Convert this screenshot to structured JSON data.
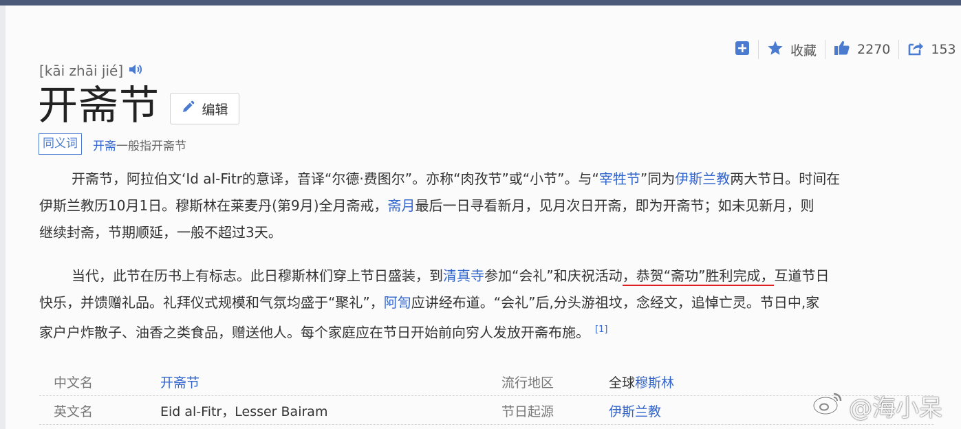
{
  "colors": {
    "accent": "#3366cc",
    "icon_blue": "#4a7bd0",
    "annotation": "#e02020"
  },
  "toolbar": {
    "add_icon": "plus-square-icon",
    "favorite_icon": "star-icon",
    "favorite_label": "收藏",
    "like_icon": "thumbs-up-icon",
    "like_count": "2270",
    "share_icon": "share-icon",
    "share_count": "153"
  },
  "entry": {
    "pinyin": "[kāi zhāi jié]",
    "speaker_icon": "speaker-icon",
    "title": "开斋节",
    "edit_label": "编辑",
    "synonym_badge": "同义词",
    "synonym_link": "开斋",
    "synonym_rest": "一般指开斋节"
  },
  "para1": {
    "l1_a": "开斋节，阿拉伯文‘Id al-Fitr的意译，音译“尔德·费图尔”。亦称“肉孜节”或“小节”。与“",
    "l1_link1": "宰牲节",
    "l1_b": "”同为",
    "l1_link2": "伊斯兰教",
    "l1_c": "两大节日。时间在",
    "l2_a": "伊斯兰教历10月1日。穆斯林在莱麦丹(第9月)全月斋戒，",
    "l2_link": "斋月",
    "l2_b": "最后一日寻看新月，见月次日开斋，即为开斋节；如未见新月，则",
    "l3": "继续封斋，节期顺延，一般不超过3天。"
  },
  "para2": {
    "l1_a": "当代，此节在历书上有标志。此日穆斯林们穿上节日盛装，到",
    "l1_link": "清真寺",
    "l1_b": "参加“会礼”和庆祝活动",
    "l1_underlined": "，恭贺“斋功”胜利完成，",
    "l1_c": "互道节日",
    "l2_a": "快乐，并馈赠礼品。礼拜仪式规模和气氛均盛于“聚礼”，",
    "l2_link": "阿訇",
    "l2_b": "应讲经布道。“会礼”后,分头游祖坟，念经文，追悼亡灵。节日中,家",
    "l3": "家户户炸散子、油香之类食品，赠送他人。每个家庭应在节日开始前向穷人发放开斋布施。",
    "ref": "[1]"
  },
  "infobox": {
    "row1": {
      "label1": "中文名",
      "value1": "开斋节",
      "label2": "流行地区",
      "value2_prefix": "全球",
      "value2_link": "穆斯林"
    },
    "row2": {
      "label1": "英文名",
      "value1": "Eid al-Fitr，Lesser Bairam",
      "label2": "节日起源",
      "value2_link": "伊斯兰教"
    }
  },
  "watermark": {
    "icon": "weibo-icon",
    "text": "@海小呆"
  }
}
